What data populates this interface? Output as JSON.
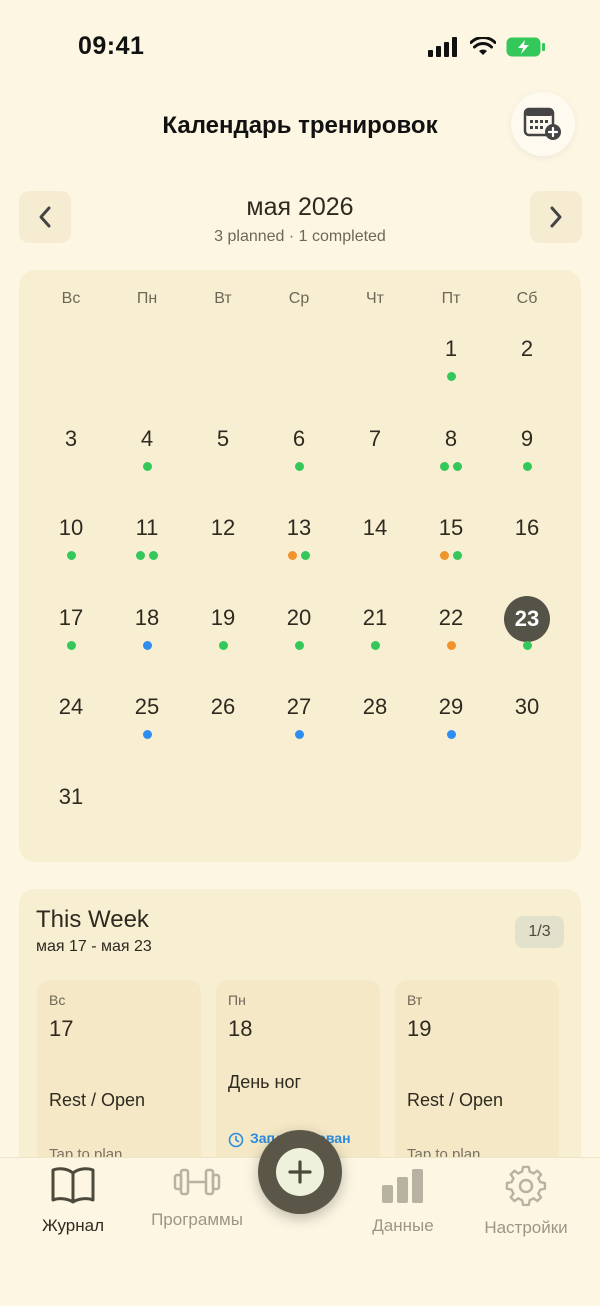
{
  "status_bar": {
    "time": "09:41"
  },
  "header": {
    "title": "Календарь тренировок"
  },
  "month": {
    "title": "мая 2026",
    "subtitle": "3 planned · 1 completed"
  },
  "weekdays": [
    "Вс",
    "Пн",
    "Вт",
    "Ср",
    "Чт",
    "Пт",
    "Сб"
  ],
  "colors": {
    "green": "#34c759",
    "orange": "#f0932b",
    "blue": "#2f8cf0",
    "selected": "#555247"
  },
  "calendar": {
    "first_weekday_index": 5,
    "selected_day": 23,
    "days": [
      {
        "d": "1",
        "dots": [
          "green"
        ]
      },
      {
        "d": "2",
        "dots": []
      },
      {
        "d": "3",
        "dots": []
      },
      {
        "d": "4",
        "dots": [
          "green"
        ]
      },
      {
        "d": "5",
        "dots": []
      },
      {
        "d": "6",
        "dots": [
          "green"
        ]
      },
      {
        "d": "7",
        "dots": []
      },
      {
        "d": "8",
        "dots": [
          "green",
          "green"
        ]
      },
      {
        "d": "9",
        "dots": [
          "green"
        ]
      },
      {
        "d": "10",
        "dots": [
          "green"
        ]
      },
      {
        "d": "11",
        "dots": [
          "green",
          "green"
        ]
      },
      {
        "d": "12",
        "dots": []
      },
      {
        "d": "13",
        "dots": [
          "orange",
          "green"
        ]
      },
      {
        "d": "14",
        "dots": []
      },
      {
        "d": "15",
        "dots": [
          "orange",
          "green"
        ]
      },
      {
        "d": "16",
        "dots": []
      },
      {
        "d": "17",
        "dots": [
          "green"
        ]
      },
      {
        "d": "18",
        "dots": [
          "blue"
        ]
      },
      {
        "d": "19",
        "dots": [
          "green"
        ]
      },
      {
        "d": "20",
        "dots": [
          "green"
        ]
      },
      {
        "d": "21",
        "dots": [
          "green"
        ]
      },
      {
        "d": "22",
        "dots": [
          "orange"
        ]
      },
      {
        "d": "23",
        "dots": [
          "green"
        ]
      },
      {
        "d": "24",
        "dots": []
      },
      {
        "d": "25",
        "dots": [
          "blue"
        ]
      },
      {
        "d": "26",
        "dots": []
      },
      {
        "d": "27",
        "dots": [
          "blue"
        ]
      },
      {
        "d": "28",
        "dots": []
      },
      {
        "d": "29",
        "dots": [
          "blue"
        ]
      },
      {
        "d": "30",
        "dots": []
      },
      {
        "d": "31",
        "dots": []
      }
    ]
  },
  "week": {
    "title": "This Week",
    "range": "мая 17 - мая 23",
    "page": "1/3",
    "days": [
      {
        "dow": "Вс",
        "num": "17",
        "label": "Rest / Open",
        "hint": "Tap to plan",
        "status": ""
      },
      {
        "dow": "Пн",
        "num": "18",
        "label": "День ног",
        "hint": "",
        "status": "Запланирован"
      },
      {
        "dow": "Вт",
        "num": "19",
        "label": "Rest / Open",
        "hint": "Tap to plan",
        "status": ""
      }
    ]
  },
  "tabs": [
    {
      "label": "Журнал",
      "icon": "book-icon",
      "active": true
    },
    {
      "label": "Программы",
      "icon": "dumbbell-icon",
      "active": false
    },
    {
      "label": "Данные",
      "icon": "bar-chart-icon",
      "active": false
    },
    {
      "label": "Настройки",
      "icon": "gear-icon",
      "active": false
    }
  ]
}
